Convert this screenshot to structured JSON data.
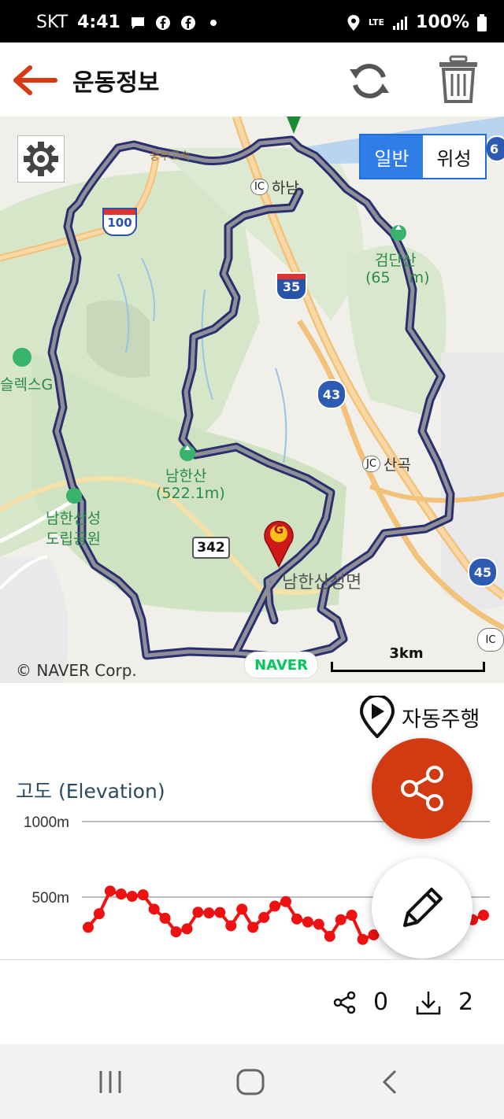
{
  "status_bar": {
    "carrier": "SKT",
    "time": "4:41",
    "network": "LTE",
    "battery": "100%"
  },
  "app_bar": {
    "title": "운동정보"
  },
  "map": {
    "map_type_options": [
      "일반",
      "위성"
    ],
    "selected_map_type": "일반",
    "labels": {
      "ic_hanam": "하남",
      "ic_badge": "IC",
      "geomdansan_a": "검단산",
      "geomdansan_b": "(65",
      "geomdansan_c": "m)",
      "namhansan_a": "남한산",
      "namhansan_b": "(522.1m)",
      "namhansanseong_a": "남한산성",
      "namhansanseong_b": "도립공원",
      "golf": "슬렉스G",
      "jc": "JC",
      "sangok": "산곡",
      "namhansanseong_short": "남한산성면",
      "route_100": "100",
      "route_35": "35",
      "route_43": "43",
      "route_45": "45",
      "route_6": "6",
      "route_342": "342",
      "top_road": "중부고속"
    },
    "naver_logo": "NAVER",
    "scale_label": "3km",
    "copyright": "© NAVER Corp.",
    "marker_letter": "G",
    "colors": {
      "route_outer": "#2a2f6e",
      "route_inner": "#8f8f9a",
      "marker": "#d01818"
    }
  },
  "autoplay_label": "자동주행",
  "elevation": {
    "title": "고도 (Elevation)"
  },
  "chart_data": {
    "type": "line",
    "title": "고도 (Elevation)",
    "ytick_labels": [
      "1000m",
      "500m"
    ],
    "y_ticks": [
      1000,
      500
    ],
    "ylim": [
      0,
      1000
    ],
    "y_visible_min": 390,
    "series": [
      {
        "values": [
          300,
          390,
          540,
          520,
          505,
          515,
          420,
          360,
          270,
          290,
          400,
          395,
          398,
          310,
          420,
          300,
          365,
          440,
          470,
          355,
          335,
          320,
          240,
          350,
          380,
          220,
          250,
          310,
          400,
          370,
          300,
          330,
          350,
          340,
          410,
          350,
          380
        ],
        "color": "#ee1111"
      }
    ]
  },
  "bottom_stats": {
    "share_count": "0",
    "download_count": "2"
  }
}
